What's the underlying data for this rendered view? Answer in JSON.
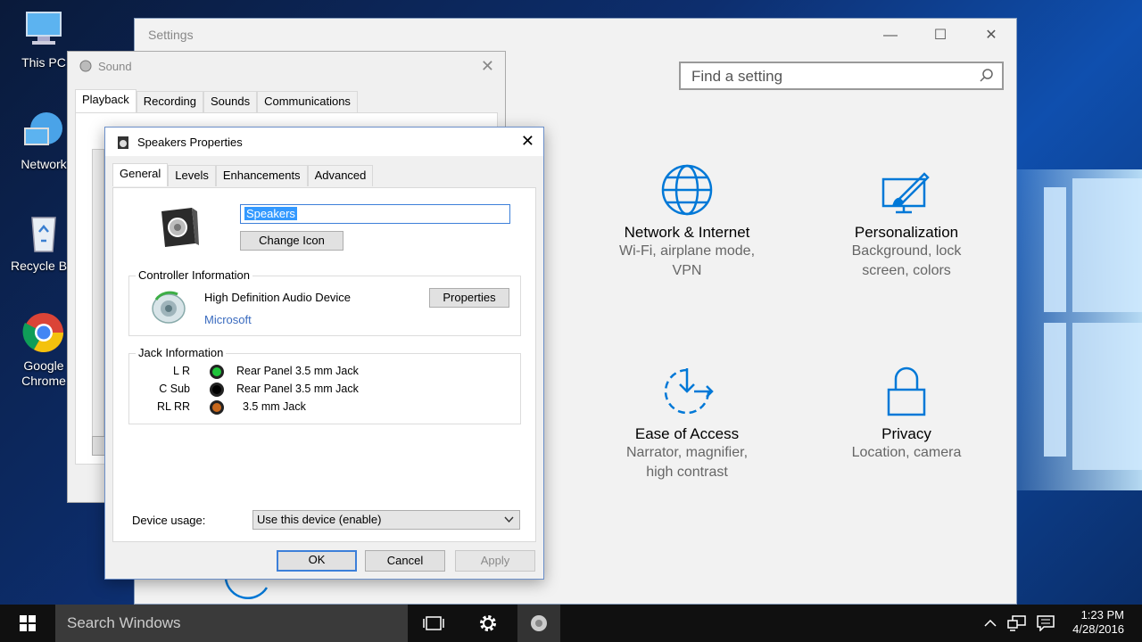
{
  "desktop": {
    "icons": [
      {
        "label": "This PC"
      },
      {
        "label": "Network"
      },
      {
        "label": "Recycle Bin"
      },
      {
        "label": "Google Chrome"
      }
    ]
  },
  "settings": {
    "title": "Settings",
    "search_placeholder": "Find a setting",
    "tiles": [
      {
        "name": "Network & Internet",
        "desc": "Wi-Fi, airplane mode, VPN",
        "icon": "globe-icon"
      },
      {
        "name": "Personalization",
        "desc": "Background, lock screen, colors",
        "icon": "paint-screen-icon"
      },
      {
        "name": "Ease of Access",
        "desc": "Narrator, magnifier, high contrast",
        "icon": "ease-of-access-icon"
      },
      {
        "name": "Privacy",
        "desc": "Location, camera",
        "icon": "lock-icon"
      }
    ],
    "accent": "#0078d7"
  },
  "sound_dialog": {
    "title": "Sound",
    "tabs": [
      "Playback",
      "Recording",
      "Sounds",
      "Communications"
    ],
    "active_tab": "Playback"
  },
  "speakers_props": {
    "title": "Speakers Properties",
    "tabs": [
      "General",
      "Levels",
      "Enhancements",
      "Advanced"
    ],
    "active_tab": "General",
    "name_value": "Speakers",
    "change_icon_label": "Change Icon",
    "controller": {
      "label": "Controller Information",
      "device": "High Definition Audio Device",
      "vendor": "Microsoft",
      "properties_label": "Properties"
    },
    "jack": {
      "label": "Jack Information",
      "rows": [
        {
          "channel": "L R",
          "color": "#1fc43a",
          "desc": "Rear Panel 3.5 mm Jack"
        },
        {
          "channel": "C Sub",
          "color": "#000000",
          "desc": "Rear Panel 3.5 mm Jack"
        },
        {
          "channel": "RL RR",
          "color": "#c8681c",
          "desc": "3.5 mm Jack"
        }
      ]
    },
    "device_usage_label": "Device usage:",
    "device_usage_value": "Use this device (enable)",
    "ok_label": "OK",
    "cancel_label": "Cancel",
    "apply_label": "Apply"
  },
  "taskbar": {
    "search_placeholder": "Search Windows",
    "time": "1:23 PM",
    "date": "4/28/2016"
  }
}
